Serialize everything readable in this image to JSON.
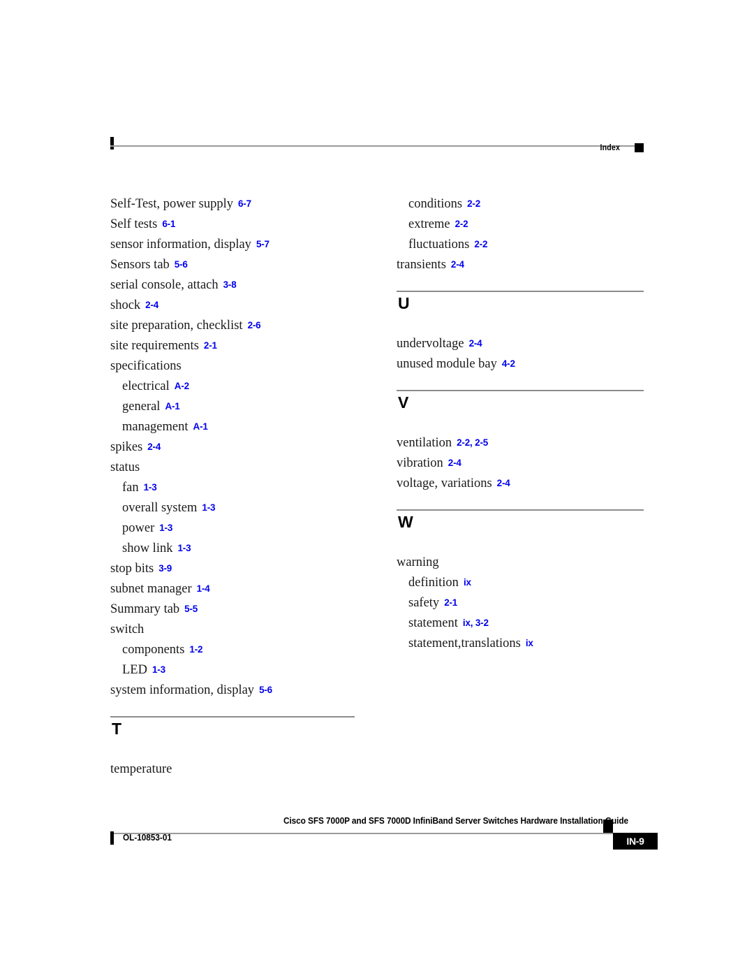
{
  "header": {
    "label": "Index"
  },
  "columns": [
    {
      "id": "left",
      "blocks": [
        {
          "type": "entries",
          "entries": [
            {
              "term": "Self-Test, power supply",
              "refs": "6-7",
              "level": 1
            },
            {
              "term": "Self tests",
              "refs": "6-1",
              "level": 1
            },
            {
              "term": "sensor information, display",
              "refs": "5-7",
              "level": 1
            },
            {
              "term": "Sensors tab",
              "refs": "5-6",
              "level": 1
            },
            {
              "term": "serial console, attach",
              "refs": "3-8",
              "level": 1
            },
            {
              "term": "shock",
              "refs": "2-4",
              "level": 1
            },
            {
              "term": "site preparation, checklist",
              "refs": "2-6",
              "level": 1
            },
            {
              "term": "site requirements",
              "refs": "2-1",
              "level": 1
            },
            {
              "term": "specifications",
              "refs": "",
              "level": 1
            },
            {
              "term": "electrical",
              "refs": "A-2",
              "level": 2
            },
            {
              "term": "general",
              "refs": "A-1",
              "level": 2
            },
            {
              "term": "management",
              "refs": "A-1",
              "level": 2
            },
            {
              "term": "spikes",
              "refs": "2-4",
              "level": 1
            },
            {
              "term": "status",
              "refs": "",
              "level": 1
            },
            {
              "term": "fan",
              "refs": "1-3",
              "level": 2
            },
            {
              "term": "overall system",
              "refs": "1-3",
              "level": 2
            },
            {
              "term": "power",
              "refs": "1-3",
              "level": 2
            },
            {
              "term": "show link",
              "refs": "1-3",
              "level": 2
            },
            {
              "term": "stop bits",
              "refs": "3-9",
              "level": 1
            },
            {
              "term": "subnet manager",
              "refs": "1-4",
              "level": 1
            },
            {
              "term": "Summary tab",
              "refs": "5-5",
              "level": 1
            },
            {
              "term": "switch",
              "refs": "",
              "level": 1
            },
            {
              "term": "components",
              "refs": "1-2",
              "level": 2
            },
            {
              "term": "LED",
              "refs": "1-3",
              "level": 2
            },
            {
              "term": "system information, display",
              "refs": "5-6",
              "level": 1
            }
          ]
        },
        {
          "type": "section",
          "letter": "T"
        },
        {
          "type": "entries",
          "entries": [
            {
              "term": "temperature",
              "refs": "",
              "level": 1
            }
          ]
        }
      ]
    },
    {
      "id": "right",
      "blocks": [
        {
          "type": "entries",
          "entries": [
            {
              "term": "conditions",
              "refs": "2-2",
              "level": 2
            },
            {
              "term": "extreme",
              "refs": "2-2",
              "level": 2
            },
            {
              "term": "fluctuations",
              "refs": "2-2",
              "level": 2
            },
            {
              "term": "transients",
              "refs": "2-4",
              "level": 1
            }
          ]
        },
        {
          "type": "section",
          "letter": "U"
        },
        {
          "type": "entries",
          "entries": [
            {
              "term": "undervoltage",
              "refs": "2-4",
              "level": 1
            },
            {
              "term": "unused module bay",
              "refs": "4-2",
              "level": 1
            }
          ]
        },
        {
          "type": "section",
          "letter": "V"
        },
        {
          "type": "entries",
          "entries": [
            {
              "term": "ventilation",
              "refs": "2-2, 2-5",
              "level": 1
            },
            {
              "term": "vibration",
              "refs": "2-4",
              "level": 1
            },
            {
              "term": "voltage, variations",
              "refs": "2-4",
              "level": 1
            }
          ]
        },
        {
          "type": "section",
          "letter": "W"
        },
        {
          "type": "entries",
          "entries": [
            {
              "term": "warning",
              "refs": "",
              "level": 1
            },
            {
              "term": "definition",
              "refs": "ix",
              "level": 2
            },
            {
              "term": "safety",
              "refs": "2-1",
              "level": 2
            },
            {
              "term": "statement",
              "refs": "ix, 3-2",
              "level": 2
            },
            {
              "term": "statement,translations",
              "refs": "ix",
              "level": 2
            }
          ]
        }
      ]
    }
  ],
  "footer": {
    "title": "Cisco SFS 7000P and SFS 7000D InfiniBand Server Switches Hardware Installation Guide",
    "doc_id": "OL-10853-01",
    "page_number": "IN-9"
  },
  "colors": {
    "reference_link": "#0000ee",
    "rule": "#9a9a9a",
    "text": "#1a1a1a"
  }
}
